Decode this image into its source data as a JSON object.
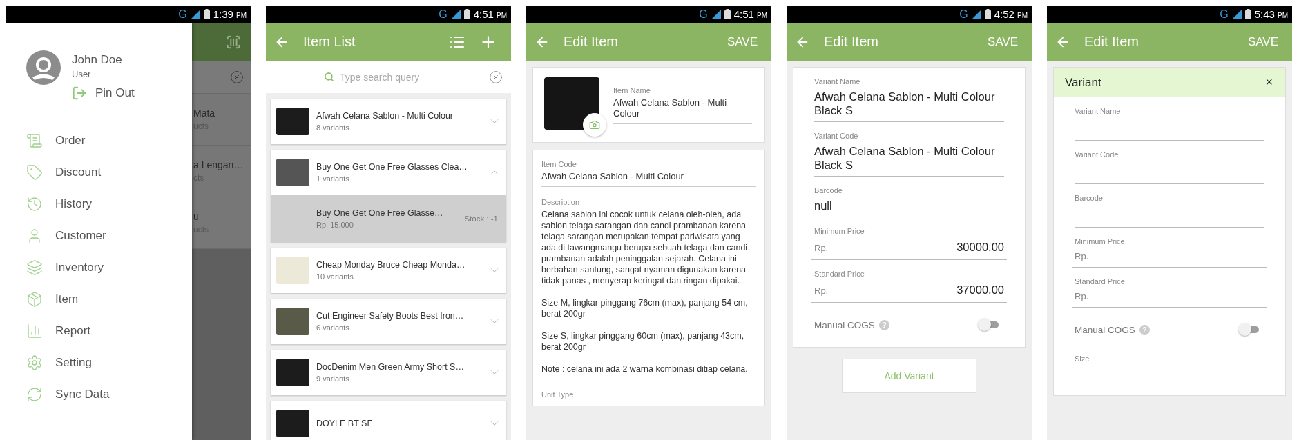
{
  "screens": [
    {
      "kind": "drawer",
      "status": {
        "network": "G",
        "time": "1:39",
        "meridiem": "PM"
      },
      "profile": {
        "name": "John Doe",
        "role": "User",
        "pin_out": "Pin Out"
      },
      "menu": [
        {
          "label": "Order"
        },
        {
          "label": "Discount"
        },
        {
          "label": "History"
        },
        {
          "label": "Customer"
        },
        {
          "label": "Inventory"
        },
        {
          "label": "Item"
        },
        {
          "label": "Report"
        },
        {
          "label": "Setting"
        },
        {
          "label": "Sync Data"
        }
      ],
      "behind_rows": [
        {
          "title": "Mata",
          "subtitle": "ucts"
        },
        {
          "title": "a Lengan…",
          "subtitle": "cts"
        },
        {
          "title": "u",
          "subtitle": "ucts"
        }
      ]
    },
    {
      "kind": "item_list",
      "status": {
        "network": "G",
        "time": "4:51",
        "meridiem": "PM"
      },
      "title": "Item List",
      "search": {
        "placeholder": "Type search query"
      },
      "items": [
        {
          "name": "Afwah Celana Sablon - Multi Colour",
          "count": "8 variants",
          "expanded": false
        },
        {
          "name": "Buy One Get One Free Glasses Clea…",
          "count": "1 variants",
          "expanded": true,
          "variants": [
            {
              "name": "Buy One Get One Free Glasse…",
              "price": "Rp. 15.000",
              "stock": "Stock : -1"
            }
          ]
        },
        {
          "name": "Cheap Monday Bruce Cheap Monda…",
          "count": "10 variants",
          "expanded": false
        },
        {
          "name": "Cut Engineer Safety Boots Best Iron…",
          "count": "6 variants",
          "expanded": false
        },
        {
          "name": "DocDenim Men Green Army Short S…",
          "count": "9 variants",
          "expanded": false
        },
        {
          "name": "DOYLE BT SF",
          "expanded": false
        }
      ]
    },
    {
      "kind": "edit_item",
      "status": {
        "network": "G",
        "time": "4:51",
        "meridiem": "PM"
      },
      "title": "Edit Item",
      "action": "SAVE",
      "item_name": {
        "label": "Item Name",
        "value": "Afwah Celana Sablon - Multi Colour"
      },
      "item_code": {
        "label": "Item Code",
        "value": "Afwah Celana Sablon - Multi Colour"
      },
      "description": {
        "label": "Description",
        "paragraphs": [
          "Celana sablon ini cocok untuk celana oleh-oleh, ada sablon telaga sarangan dan candi prambanan karena telaga sarangan merupakan tempat pariwisata yang ada di tawangmangu berupa sebuah telaga dan candi prambanan adalah peninggalan sejarah. Celana ini berbahan santung, sangat nyaman digunakan karena tidak panas , menyerap keringat dan ringan dipakai.",
          "Size M, lingkar pinggang 76cm (max), panjang 54 cm, berat 200gr",
          "Size S, lingkar pinggang 60cm (max), panjang 43cm, berat 200gr",
          "Note : celana ini ada 2 warna kombinasi ditiap celana."
        ]
      },
      "unit_type": {
        "label": "Unit Type"
      }
    },
    {
      "kind": "variant_edit",
      "status": {
        "network": "G",
        "time": "4:52",
        "meridiem": "PM"
      },
      "title": "Edit Item",
      "action": "SAVE",
      "fields": [
        {
          "kind": "text",
          "label": "Variant Name",
          "value": "Afwah Celana Sablon - Multi Colour Black S"
        },
        {
          "kind": "text",
          "label": "Variant Code",
          "value": "Afwah Celana Sablon - Multi Colour Black S"
        },
        {
          "kind": "text",
          "label": "Barcode",
          "value": "null"
        },
        {
          "kind": "price",
          "label": "Minimum Price",
          "prefix": "Rp.",
          "value": "30000.00"
        },
        {
          "kind": "price",
          "label": "Standard Price",
          "prefix": "Rp.",
          "value": "37000.00"
        },
        {
          "kind": "toggle",
          "label": "Manual COGS",
          "help": "?",
          "on": false
        }
      ],
      "button": "Add Variant"
    },
    {
      "kind": "variant_form",
      "status": {
        "network": "G",
        "time": "5:43",
        "meridiem": "PM"
      },
      "title": "Edit Item",
      "action": "SAVE",
      "dialog": {
        "title": "Variant",
        "close": "×",
        "fields": [
          {
            "kind": "text",
            "label": "Variant Name"
          },
          {
            "kind": "text",
            "label": "Variant Code"
          },
          {
            "kind": "text",
            "label": "Barcode"
          },
          {
            "kind": "price",
            "label": "Minimum Price",
            "prefix": "Rp."
          },
          {
            "kind": "price",
            "label": "Standard Price",
            "prefix": "Rp."
          },
          {
            "kind": "toggle",
            "label": "Manual COGS",
            "help": "?",
            "on": false
          },
          {
            "kind": "text",
            "label": "Size"
          }
        ]
      }
    }
  ]
}
